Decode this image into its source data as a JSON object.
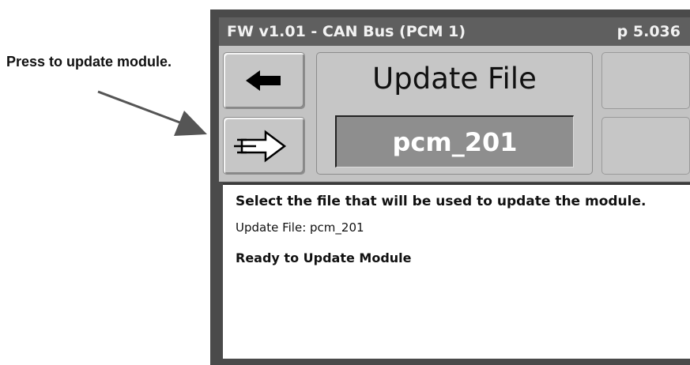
{
  "callout": {
    "text": "Press to update module."
  },
  "titlebar": {
    "left": "FW v1.01 - CAN Bus  (PCM 1)",
    "right": "p 5.036"
  },
  "buttons": {
    "back": "back-arrow-icon",
    "update": "update-module-icon"
  },
  "center": {
    "title": "Update File",
    "value": "pcm_201"
  },
  "info": {
    "heading": "Select the file that will be used to update the module.",
    "file_line": "Update File: pcm_201",
    "status": "Ready to Update Module"
  }
}
